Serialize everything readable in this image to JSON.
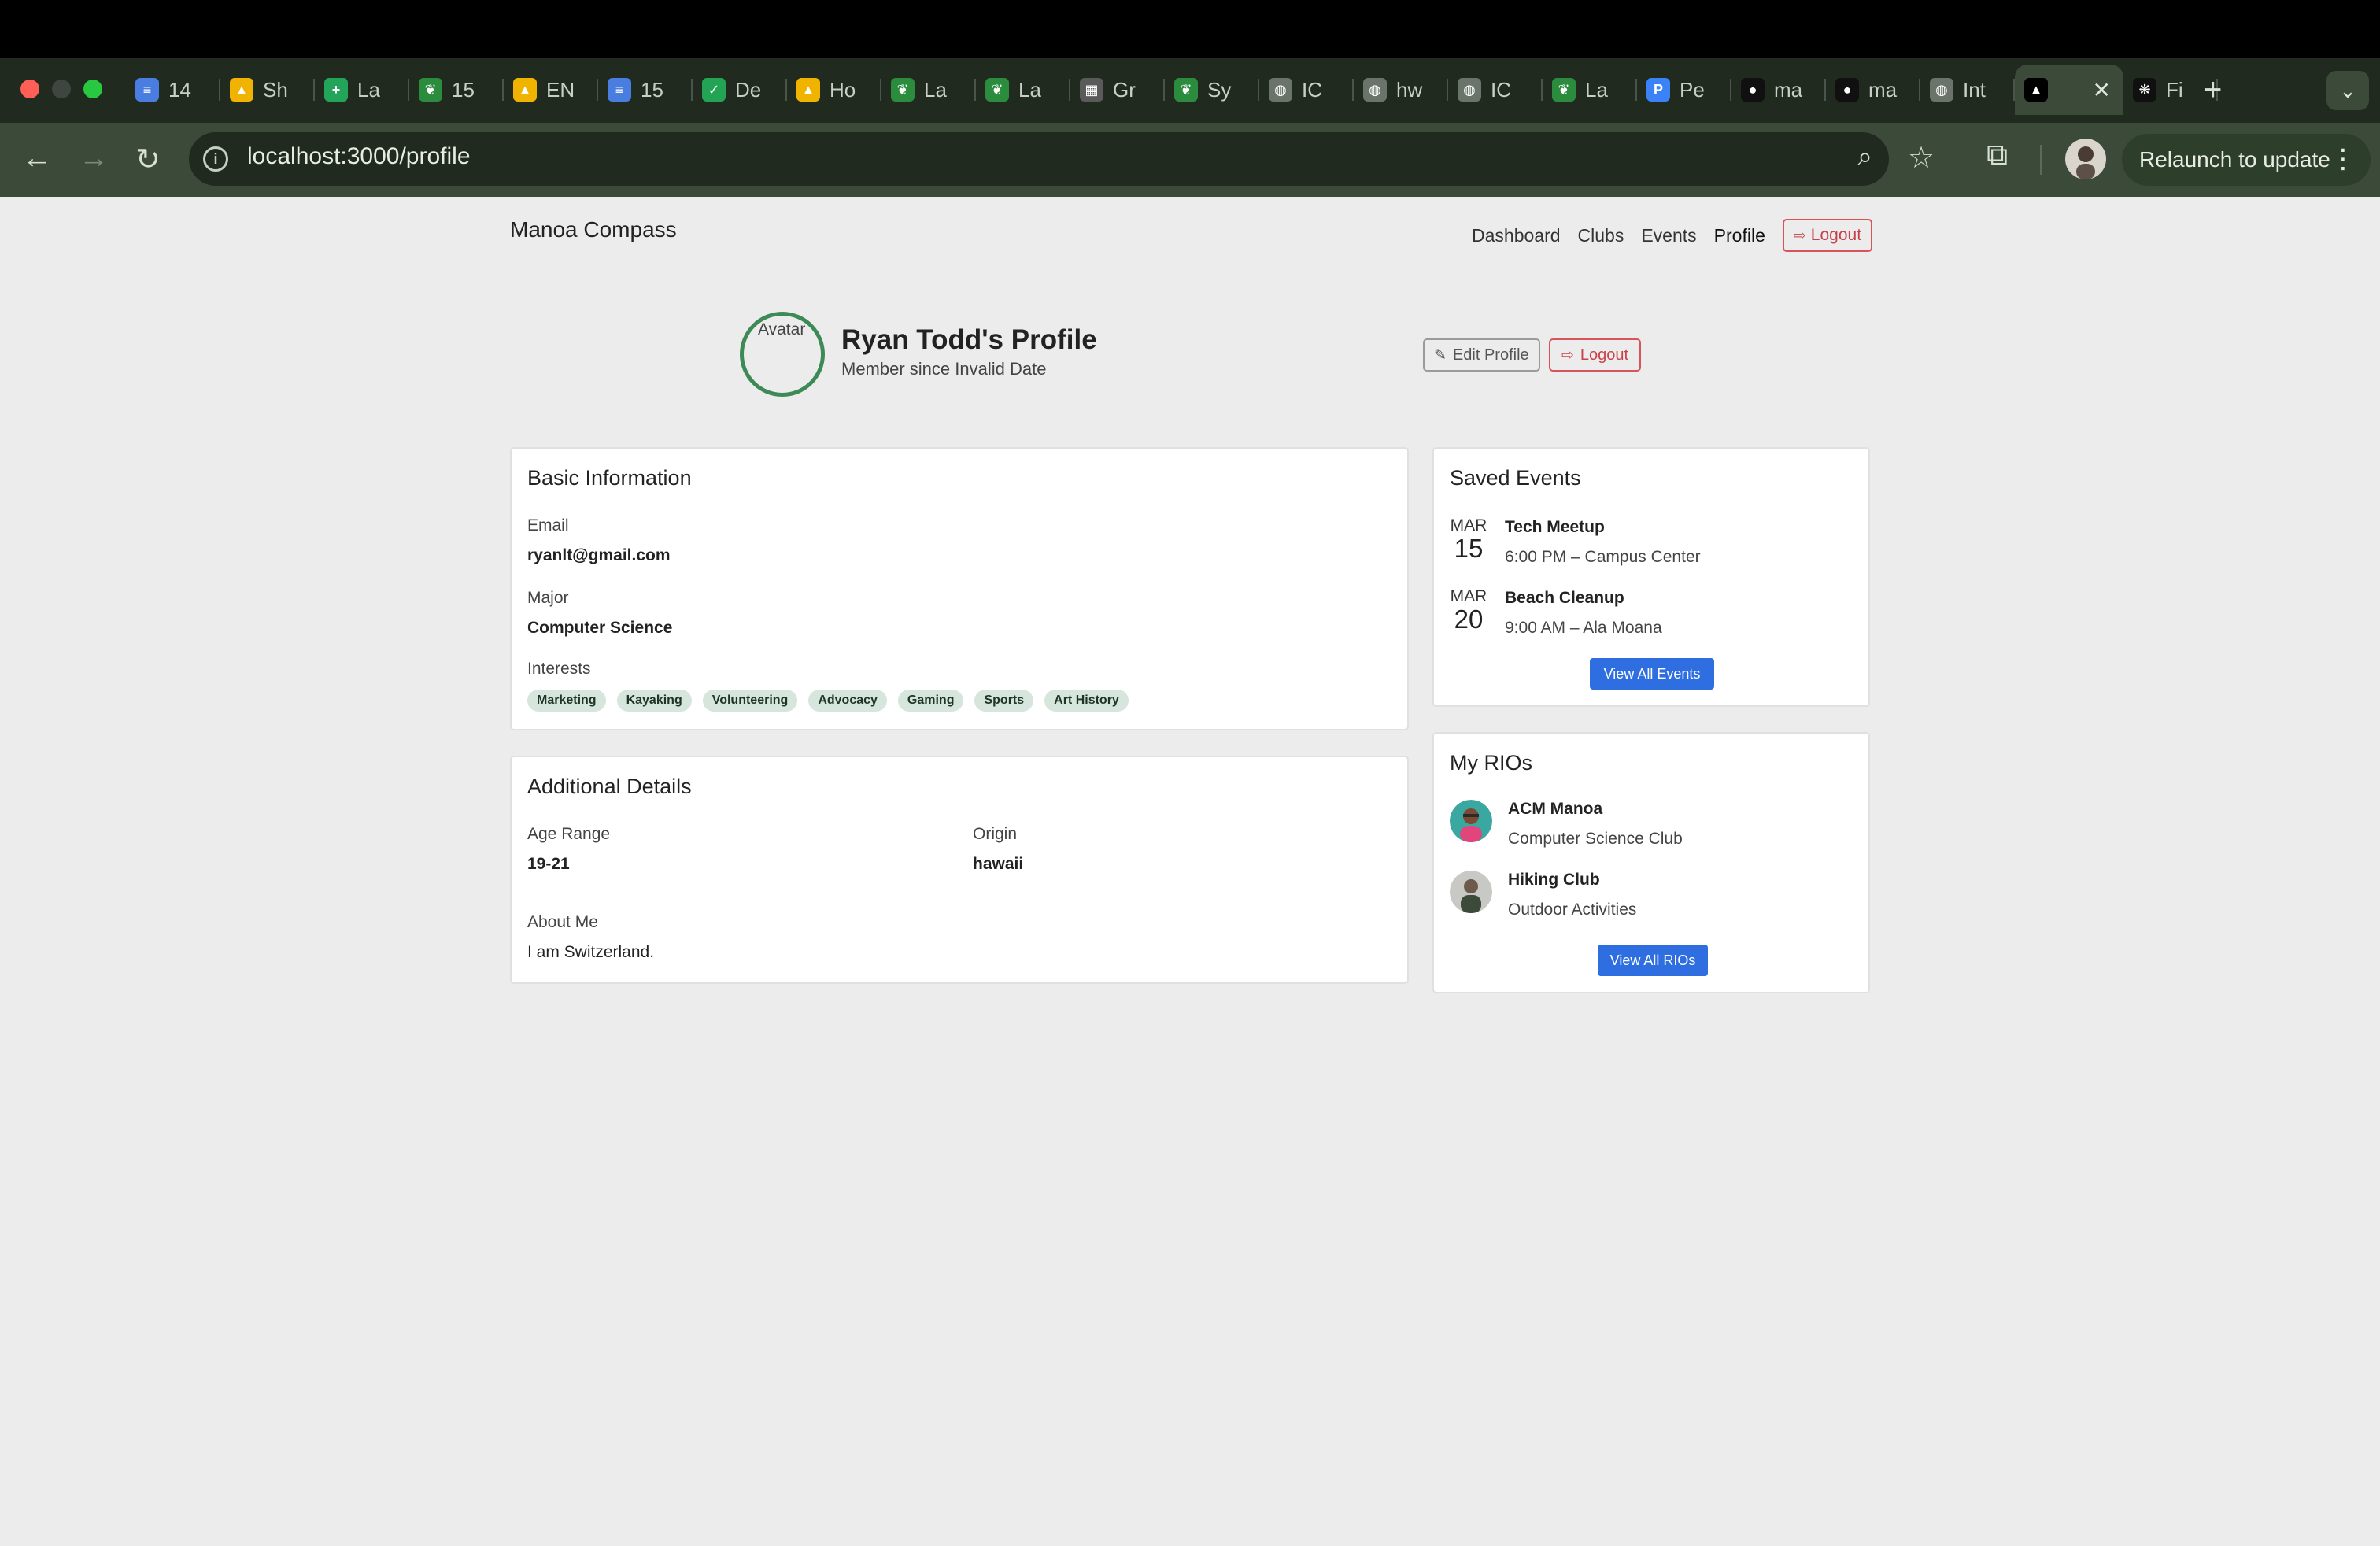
{
  "browser": {
    "tabs": [
      {
        "label": "14",
        "icon": "google-docs-icon",
        "color": "#4a7de0"
      },
      {
        "label": "Sh",
        "icon": "google-drive-icon",
        "color": "#f0b400"
      },
      {
        "label": "La",
        "icon": "google-sheets-icon",
        "color": "#22a559"
      },
      {
        "label": "15",
        "icon": "leaf-icon",
        "color": "#2c8c3e"
      },
      {
        "label": "EN",
        "icon": "google-drive-icon",
        "color": "#f0b400"
      },
      {
        "label": "15",
        "icon": "google-docs-icon",
        "color": "#4a7de0"
      },
      {
        "label": "De",
        "icon": "chart-icon",
        "color": "#23a455"
      },
      {
        "label": "Ho",
        "icon": "google-drive-icon",
        "color": "#f0b400"
      },
      {
        "label": "La",
        "icon": "leaf-icon",
        "color": "#2c8c3e"
      },
      {
        "label": "La",
        "icon": "leaf-icon",
        "color": "#2c8c3e"
      },
      {
        "label": "Gr",
        "icon": "calculator-icon",
        "color": "#5a5a5a"
      },
      {
        "label": "Sy",
        "icon": "leaf-icon",
        "color": "#2c8c3e"
      },
      {
        "label": "IC",
        "icon": "globe-icon",
        "color": "#6a746a"
      },
      {
        "label": "hw",
        "icon": "globe-icon",
        "color": "#6a746a"
      },
      {
        "label": "IC",
        "icon": "globe-icon",
        "color": "#6a746a"
      },
      {
        "label": "La",
        "icon": "leaf-icon",
        "color": "#2c8c3e"
      },
      {
        "label": "Pe",
        "icon": "p-icon",
        "color": "#3b82f6"
      },
      {
        "label": "ma",
        "icon": "github-icon",
        "color": "#101010"
      },
      {
        "label": "ma",
        "icon": "github-icon",
        "color": "#101010"
      },
      {
        "label": "Int",
        "icon": "globe-icon",
        "color": "#6a746a"
      },
      {
        "label": "",
        "icon": "triangle-icon",
        "color": "#000000",
        "active": true
      },
      {
        "label": "Fi",
        "icon": "openai-icon",
        "color": "#101010"
      }
    ],
    "new_tab": "+",
    "tab_menu": "⌄",
    "url_icon": "i",
    "url": "localhost:3000/profile",
    "relaunch_label": "Relaunch to update",
    "relaunch_menu": "⋮",
    "back": "←",
    "forward": "→",
    "reload": "↻",
    "zoom": "⌕",
    "star": "☆",
    "extensions": "⧉"
  },
  "header": {
    "brand": "Manoa Compass",
    "nav": [
      "Dashboard",
      "Clubs",
      "Events",
      "Profile"
    ],
    "logout": "Logout"
  },
  "profile": {
    "avatar_alt": "Avatar",
    "name": "Ryan Todd's Profile",
    "since": "Member since Invalid Date",
    "edit_label": "Edit Profile",
    "logout_label": "Logout"
  },
  "basic_info": {
    "title": "Basic Information",
    "email_label": "Email",
    "email": "ryanlt@gmail.com",
    "major_label": "Major",
    "major": "Computer Science",
    "interests_label": "Interests",
    "interests": [
      "Marketing",
      "Kayaking",
      "Volunteering",
      "Advocacy",
      "Gaming",
      "Sports",
      "Art History"
    ]
  },
  "additional": {
    "title": "Additional Details",
    "age_label": "Age Range",
    "age": "19-21",
    "origin_label": "Origin",
    "origin": "hawaii",
    "about_label": "About Me",
    "about": "I am Switzerland."
  },
  "saved_events": {
    "title": "Saved Events",
    "events": [
      {
        "month": "MAR",
        "day": "15",
        "title": "Tech Meetup",
        "detail": "6:00 PM – Campus Center"
      },
      {
        "month": "MAR",
        "day": "20",
        "title": "Beach Cleanup",
        "detail": "9:00 AM – Ala Moana"
      }
    ],
    "button": "View All Events"
  },
  "rios": {
    "title": "My RIOs",
    "items": [
      {
        "name": "ACM Manoa",
        "sub": "Computer Science Club"
      },
      {
        "name": "Hiking Club",
        "sub": "Outdoor Activities"
      }
    ],
    "button": "View All RIOs"
  }
}
